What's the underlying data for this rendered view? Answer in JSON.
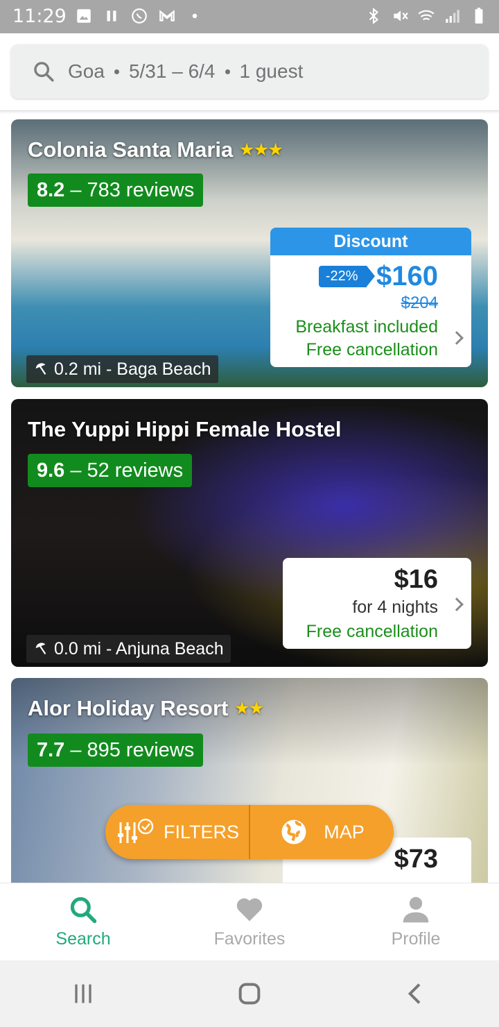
{
  "status_bar": {
    "time": "11:29"
  },
  "search": {
    "location": "Goa",
    "dates": "5/31 – 6/4",
    "guests": "1 guest"
  },
  "listings": [
    {
      "name": "Colonia Santa Maria",
      "stars": "★★★",
      "score": "8.2",
      "dash": "–",
      "reviews": "783 reviews",
      "distance": "0.2 mi - Baga Beach",
      "discount_label": "Discount",
      "discount_pct": "-22%",
      "price": "$160",
      "old_price": "$204",
      "perk1": "Breakfast included",
      "perk2": "Free cancellation"
    },
    {
      "name": "The Yuppi Hippi Female Hostel",
      "score": "9.6",
      "dash": "–",
      "reviews": "52 reviews",
      "distance": "0.0 mi - Anjuna Beach",
      "price": "$16",
      "nights": "for 4 nights",
      "perk1": "Free cancellation"
    },
    {
      "name": "Alor Holiday Resort",
      "stars": "★★",
      "score": "7.7",
      "dash": "–",
      "reviews": "895 reviews",
      "price": "$73"
    }
  ],
  "fab": {
    "filters": "FILTERS",
    "map": "MAP"
  },
  "bottom_nav": {
    "search": "Search",
    "favorites": "Favorites",
    "profile": "Profile"
  },
  "colors": {
    "accent": "#23a97a",
    "rating_green": "#128b1e",
    "fab_orange": "#f5a02a",
    "price_blue": "#2089e0"
  }
}
